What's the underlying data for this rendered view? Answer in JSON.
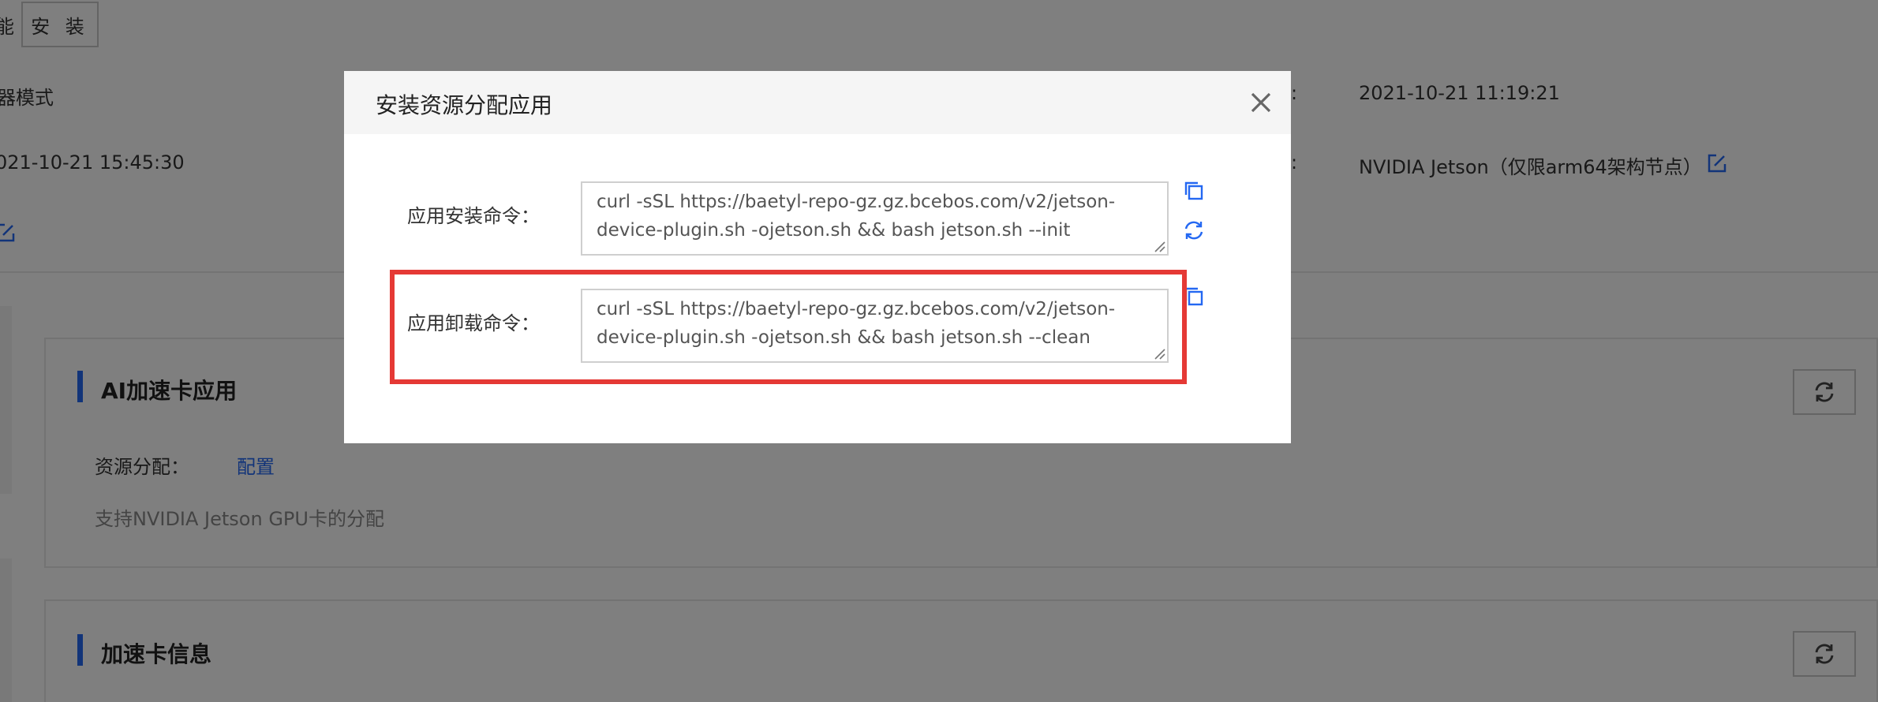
{
  "background": {
    "top_left_cut_char": "能",
    "install_button": "安 装",
    "row1_left": "器模式",
    "row1_right_sep": ":",
    "row1_right_value": "2021-10-21 11:19:21",
    "row2_left": "021-10-21 15:45:30",
    "row2_right_sep": ":",
    "row2_right_value": "NVIDIA Jetson（仅限arm64架构节点）",
    "ai_card": {
      "title": "AI加速卡应用",
      "resource_label": "资源分配：",
      "resource_link": "配置",
      "description": "支持NVIDIA Jetson GPU卡的分配"
    },
    "accel_card": {
      "title": "加速卡信息"
    }
  },
  "modal": {
    "title": "安装资源分配应用",
    "install": {
      "label": "应用安装命令：",
      "line1": "curl -sSL https://baetyl-repo-gz.gz.bcebos.com/v2/jetson-",
      "line2": "device-plugin.sh -ojetson.sh && bash jetson.sh --init"
    },
    "uninstall": {
      "label": "应用卸载命令：",
      "line1": "curl -sSL https://baetyl-repo-gz.gz.bcebos.com/v2/jetson-",
      "line2": "device-plugin.sh -ojetson.sh && bash jetson.sh --clean"
    }
  },
  "colors": {
    "accent": "#2468f2",
    "highlight": "#e53935",
    "mask": "rgba(0,0,0,0.5)"
  },
  "icons": [
    "copy-icon",
    "refresh-icon",
    "close-icon",
    "edit-icon",
    "resize-grip-icon"
  ]
}
